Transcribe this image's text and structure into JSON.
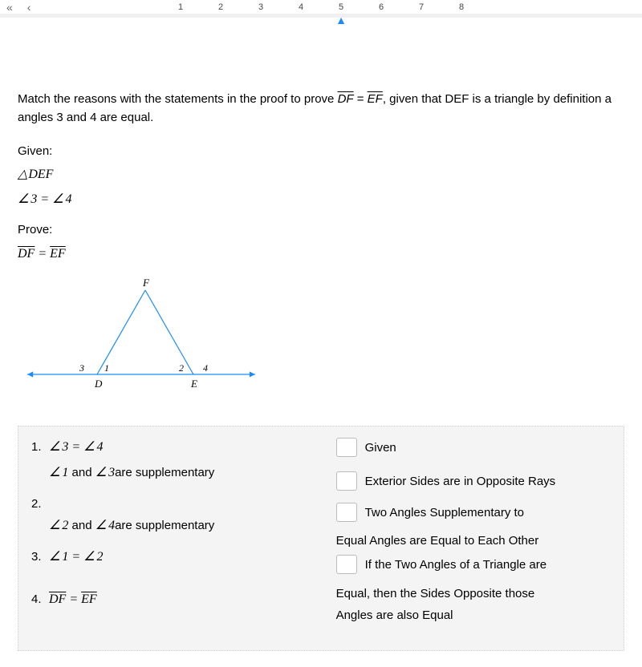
{
  "nav": {
    "nums": [
      "1",
      "2",
      "3",
      "4",
      "5",
      "6",
      "7",
      "8"
    ],
    "current": "5"
  },
  "intro": "Match the reasons with the statements in the proof to prove D͞F = E͞F, given that DEF is a triangle by definition a",
  "intro2": "angles 3 and 4 are equal.",
  "given_label": "Given:",
  "given1": "DEF",
  "given2_l": "3 =",
  "given2_r": "4",
  "prove_label": "Prove:",
  "prove1_l": "DF",
  "prove1_eq": " = ",
  "prove1_r": "EF",
  "fig": {
    "F": "F",
    "D": "D",
    "E": "E",
    "a3": "3",
    "a1": "1",
    "a2": "2",
    "a4": "4"
  },
  "proof": {
    "n1": "1.",
    "s1_l": "3 =",
    "s1_r": "4",
    "s1b_a": "1",
    "s1b_mid": " and ",
    "s1b_b": "3",
    "s1b_end": "are supplementary",
    "n2": "2.",
    "s2_a": "2",
    "s2_mid": " and ",
    "s2_b": "4",
    "s2_end": "are supplementary",
    "n3": "3.",
    "s3_l": "1 =",
    "s3_r": "2",
    "n4": "4.",
    "s4_l": "DF",
    "s4_eq": " = ",
    "s4_r": "EF"
  },
  "reasons": {
    "r1": "Given",
    "r2": "Exterior Sides are in Opposite Rays",
    "r3a": "Two Angles Supplementary to",
    "r3b": "Equal Angles are Equal to Each Other",
    "r4a": "If the Two Angles of a Triangle are",
    "r4b": "Equal, then the Sides Opposite those",
    "r4c": "Angles are also Equal"
  }
}
